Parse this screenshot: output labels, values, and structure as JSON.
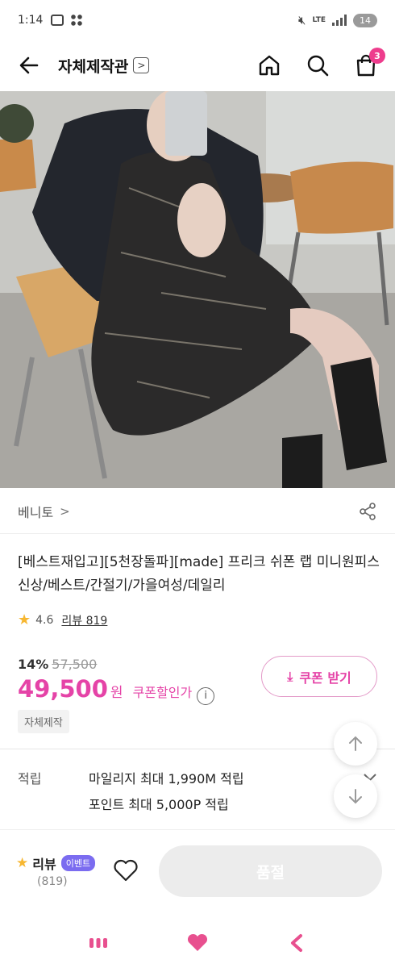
{
  "status_bar": {
    "time": "1:14",
    "network": "LTE",
    "battery": "14"
  },
  "header": {
    "title": "자체제작관",
    "title_chevron": ">",
    "cart_count": "3",
    "icons": [
      "back-arrow-icon",
      "home-icon",
      "search-icon",
      "shopping-bag-icon"
    ]
  },
  "seller": {
    "name": "베니토",
    "chevron": ">"
  },
  "product": {
    "title": "[베스트재입고][5천장돌파][made] 프리크 쉬폰 랩 미니원피스 신상/베스트/간절기/가을여성/데일리",
    "rating": "4.6",
    "review_link": "리뷰 819"
  },
  "price": {
    "discount_rate": "14%",
    "original_price": "57,500",
    "final_price": "49,500",
    "currency": "원",
    "coupon_discount_label": "쿠폰할인가",
    "info_glyph": "i",
    "coupon_button_label": "쿠폰 받기",
    "accent_color": "#e543a7"
  },
  "tag": "자체제작",
  "points": {
    "label": "적립",
    "line1": "마일리지 최대 1,990M 적립",
    "line2": "포인트 최대 5,000P 적립"
  },
  "bottom_bar": {
    "review_label": "리뷰",
    "event_badge": "이벤트",
    "review_count": "(819)",
    "soldout_label": "품절"
  },
  "navbar": {
    "icons": [
      "recent-apps-icon",
      "home-heart-icon",
      "back-icon"
    ]
  }
}
